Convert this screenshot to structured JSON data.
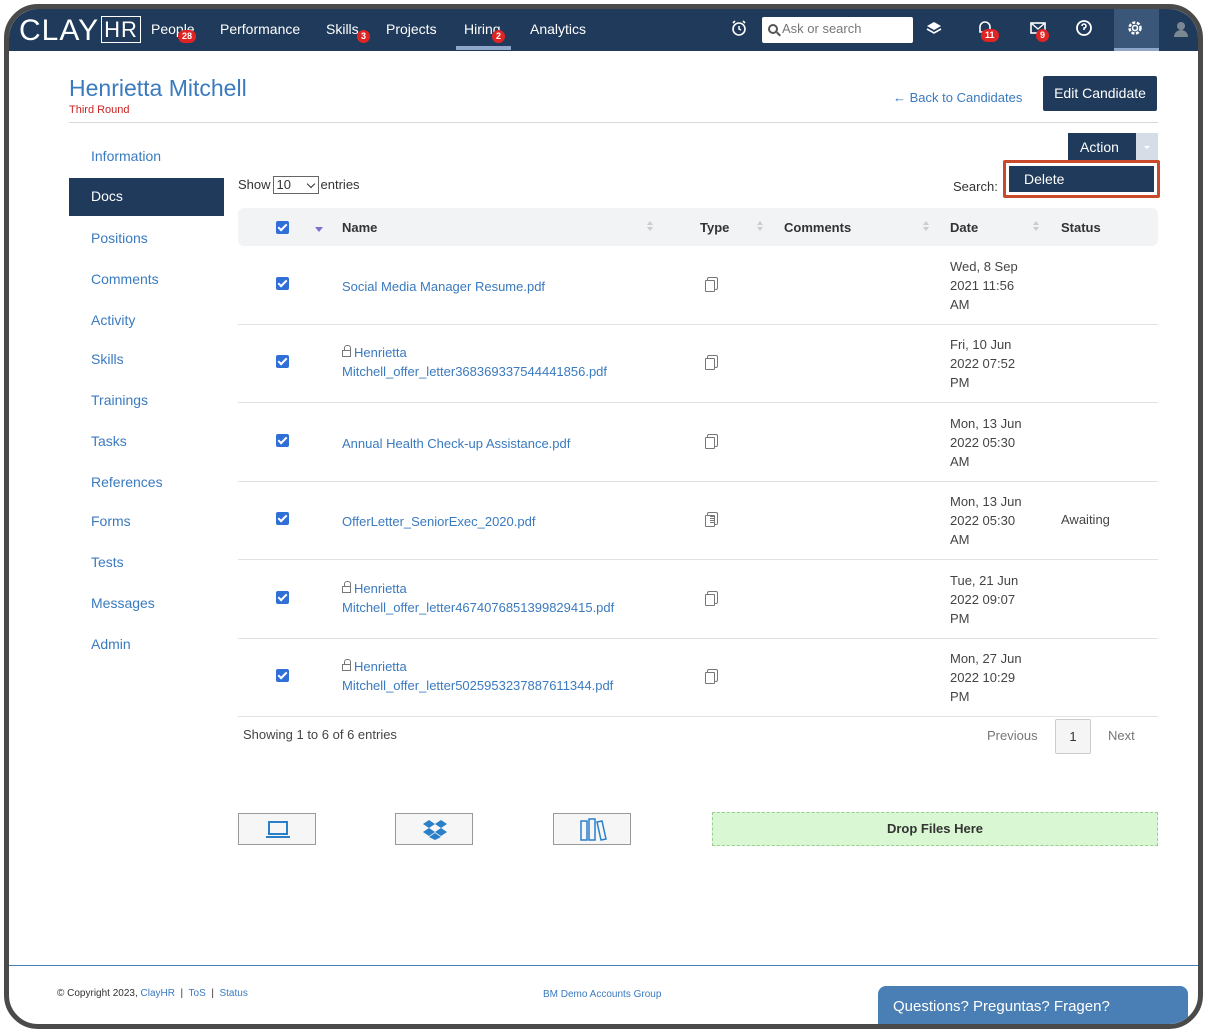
{
  "nav": {
    "logo_main": "CLAY",
    "logo_hr": "HR",
    "items": [
      {
        "label": "People",
        "badge": "28"
      },
      {
        "label": "Performance",
        "badge": ""
      },
      {
        "label": "Skills",
        "badge": "3"
      },
      {
        "label": "Projects",
        "badge": ""
      },
      {
        "label": "Hiring",
        "badge": "2"
      },
      {
        "label": "Analytics",
        "badge": ""
      }
    ],
    "search_placeholder": "Ask or search",
    "notifications_badge": "11",
    "messages_badge": "9"
  },
  "candidate": {
    "name": "Henrietta Mitchell",
    "round": "Third Round",
    "back_link": "Back to Candidates",
    "edit_button": "Edit Candidate"
  },
  "sidebar": {
    "items": [
      "Information",
      "Docs",
      "Positions",
      "Comments",
      "Activity",
      "Skills",
      "Trainings",
      "Tasks",
      "References",
      "Forms",
      "Tests",
      "Messages",
      "Admin"
    ],
    "active": "Docs"
  },
  "table_controls": {
    "show_label": "Show",
    "entries_value": "10",
    "entries_label": "entries",
    "search_label": "Search:",
    "action_button": "Action",
    "dropdown_option": "Delete"
  },
  "table": {
    "headers": [
      "Name",
      "Type",
      "Comments",
      "Date",
      "Status"
    ],
    "rows": [
      {
        "name_line1": "Social Media Manager Resume.pdf",
        "name_line2": "",
        "locked": false,
        "type": "document",
        "comments": "",
        "date_line1": "Wed, 8 Sep",
        "date_line2": "2021 11:56",
        "date_line3": "AM",
        "status": ""
      },
      {
        "name_line1": "Henrietta",
        "name_line2": "Mitchell_offer_letter368369337544441856.pdf",
        "locked": true,
        "type": "document",
        "comments": "",
        "date_line1": "Fri, 10 Jun",
        "date_line2": "2022 07:52",
        "date_line3": "PM",
        "status": ""
      },
      {
        "name_line1": "Annual Health Check-up Assistance.pdf",
        "name_line2": "",
        "locked": false,
        "type": "document",
        "comments": "",
        "date_line1": "Mon, 13 Jun",
        "date_line2": "2022 05:30",
        "date_line3": "AM",
        "status": ""
      },
      {
        "name_line1": "OfferLetter_SeniorExec_2020.pdf",
        "name_line2": "",
        "locked": false,
        "type": "form",
        "comments": "",
        "date_line1": "Mon, 13 Jun",
        "date_line2": "2022 05:30",
        "date_line3": "AM",
        "status": "Awaiting"
      },
      {
        "name_line1": "Henrietta",
        "name_line2": "Mitchell_offer_letter4674076851399829415.pdf",
        "locked": true,
        "type": "document",
        "comments": "",
        "date_line1": "Tue, 21 Jun",
        "date_line2": "2022 09:07",
        "date_line3": "PM",
        "status": ""
      },
      {
        "name_line1": "Henrietta",
        "name_line2": "Mitchell_offer_letter5025953237887611344.pdf",
        "locked": true,
        "type": "document",
        "comments": "",
        "date_line1": "Mon, 27 Jun",
        "date_line2": "2022 10:29",
        "date_line3": "PM",
        "status": ""
      }
    ]
  },
  "pagination": {
    "showing": "Showing 1 to 6 of 6 entries",
    "previous": "Previous",
    "page": "1",
    "next": "Next"
  },
  "upload": {
    "dropzone": "Drop Files Here",
    "sources": [
      "computer-icon",
      "dropbox-icon",
      "library-icon"
    ]
  },
  "footer": {
    "copyright": "© Copyright 2023,",
    "brand_link": "ClayHR",
    "tos": "ToS",
    "status": "Status",
    "group": "BM Demo Accounts Group",
    "help": "Questions? Preguntas? Fragen?"
  },
  "colors": {
    "nav_bg": "#1f3a5a",
    "link": "#3a7abf",
    "badge": "#e02424",
    "highlight": "#c94a2a",
    "dropzone": "#d8f7d2"
  }
}
